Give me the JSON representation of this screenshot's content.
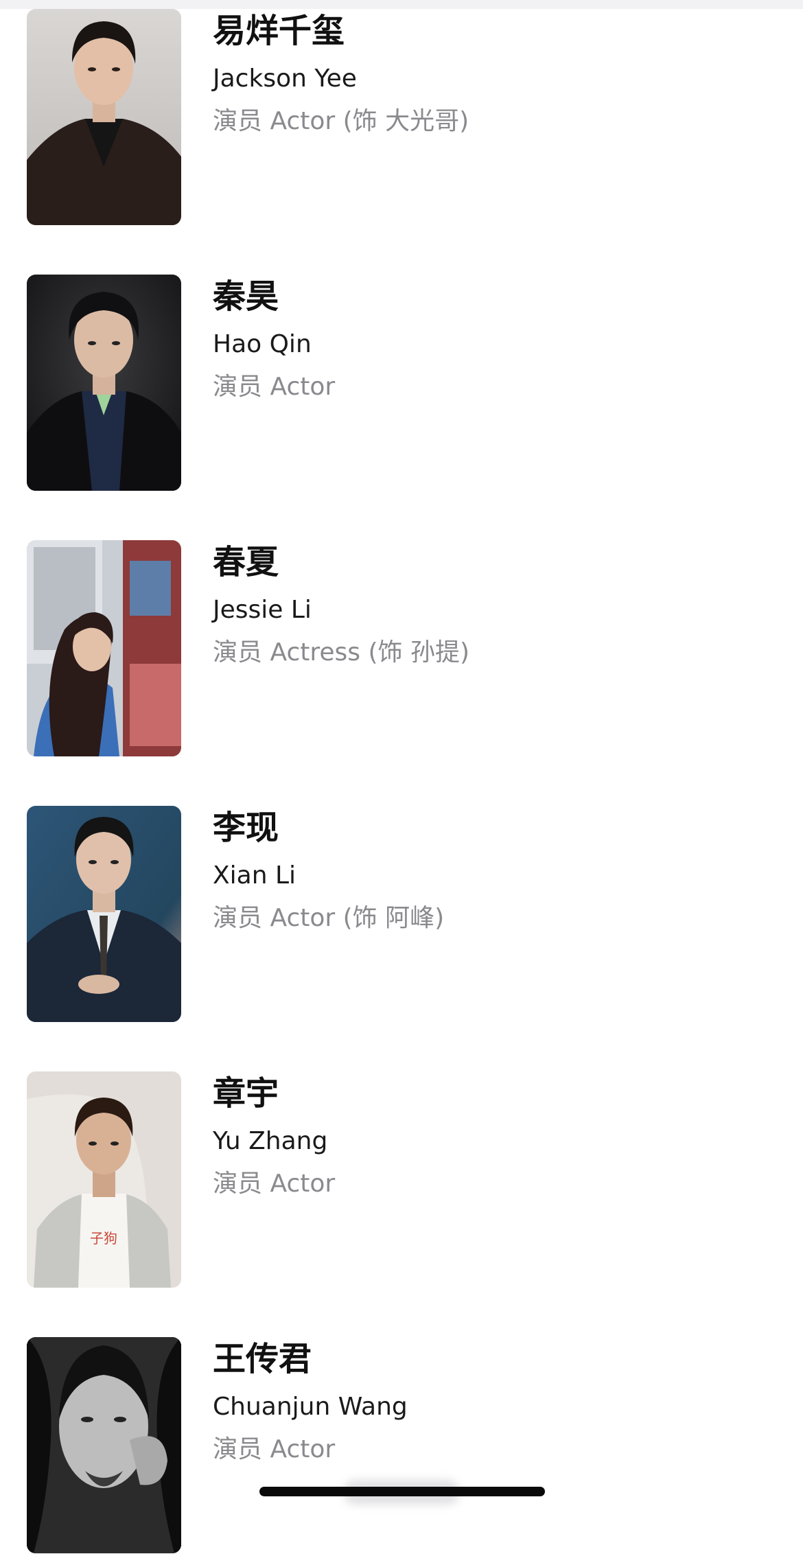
{
  "cast": [
    {
      "name_zh": "易烊千玺",
      "name_en": "Jackson Yee",
      "role": "演员 Actor (饰 大光哥)",
      "portrait_icon": "actor-portrait-photo"
    },
    {
      "name_zh": "秦昊",
      "name_en": "Hao Qin",
      "role": "演员 Actor",
      "portrait_icon": "actor-portrait-photo"
    },
    {
      "name_zh": "春夏",
      "name_en": "Jessie Li",
      "role": "演员 Actress (饰 孙提)",
      "portrait_icon": "actor-portrait-photo"
    },
    {
      "name_zh": "李现",
      "name_en": "Xian Li",
      "role": "演员 Actor (饰 阿峰)",
      "portrait_icon": "actor-portrait-photo"
    },
    {
      "name_zh": "章宇",
      "name_en": "Yu Zhang",
      "role": "演员 Actor",
      "portrait_icon": "actor-portrait-photo"
    },
    {
      "name_zh": "王传君",
      "name_en": "Chuanjun Wang",
      "role": "演员 Actor",
      "portrait_icon": "actor-portrait-photo"
    }
  ],
  "colors": {
    "background": "#ffffff",
    "name_text": "#111111",
    "role_text": "#8a8a8e",
    "home_indicator": "#0a0a0a"
  }
}
